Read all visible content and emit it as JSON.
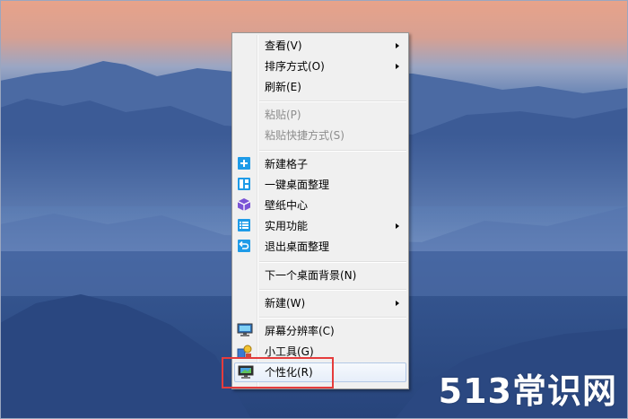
{
  "menu": {
    "items": [
      {
        "label": "查看(V)",
        "submenu": true
      },
      {
        "label": "排序方式(O)",
        "submenu": true
      },
      {
        "label": "刷新(E)"
      },
      {
        "label": "粘贴(P)",
        "disabled": true
      },
      {
        "label": "粘贴快捷方式(S)",
        "disabled": true
      },
      {
        "label": "新建格子",
        "icon": "plus-square-icon"
      },
      {
        "label": "一键桌面整理",
        "icon": "layout-grid-icon"
      },
      {
        "label": "壁纸中心",
        "icon": "cube-icon"
      },
      {
        "label": "实用功能",
        "icon": "list-icon",
        "submenu": true
      },
      {
        "label": "退出桌面整理",
        "icon": "undo-arrow-icon"
      },
      {
        "label": "下一个桌面背景(N)"
      },
      {
        "label": "新建(W)",
        "submenu": true
      },
      {
        "label": "屏幕分辨率(C)",
        "icon": "monitor-icon"
      },
      {
        "label": "小工具(G)",
        "icon": "gadgets-icon"
      },
      {
        "label": "个性化(R)",
        "icon": "personalize-monitor-icon",
        "hovered": true
      }
    ]
  },
  "watermark": "513常识网",
  "colors": {
    "accent_icon": "#1e9be8",
    "highlight_box": "#e53c3c",
    "menu_bg": "#f0f0f0"
  }
}
